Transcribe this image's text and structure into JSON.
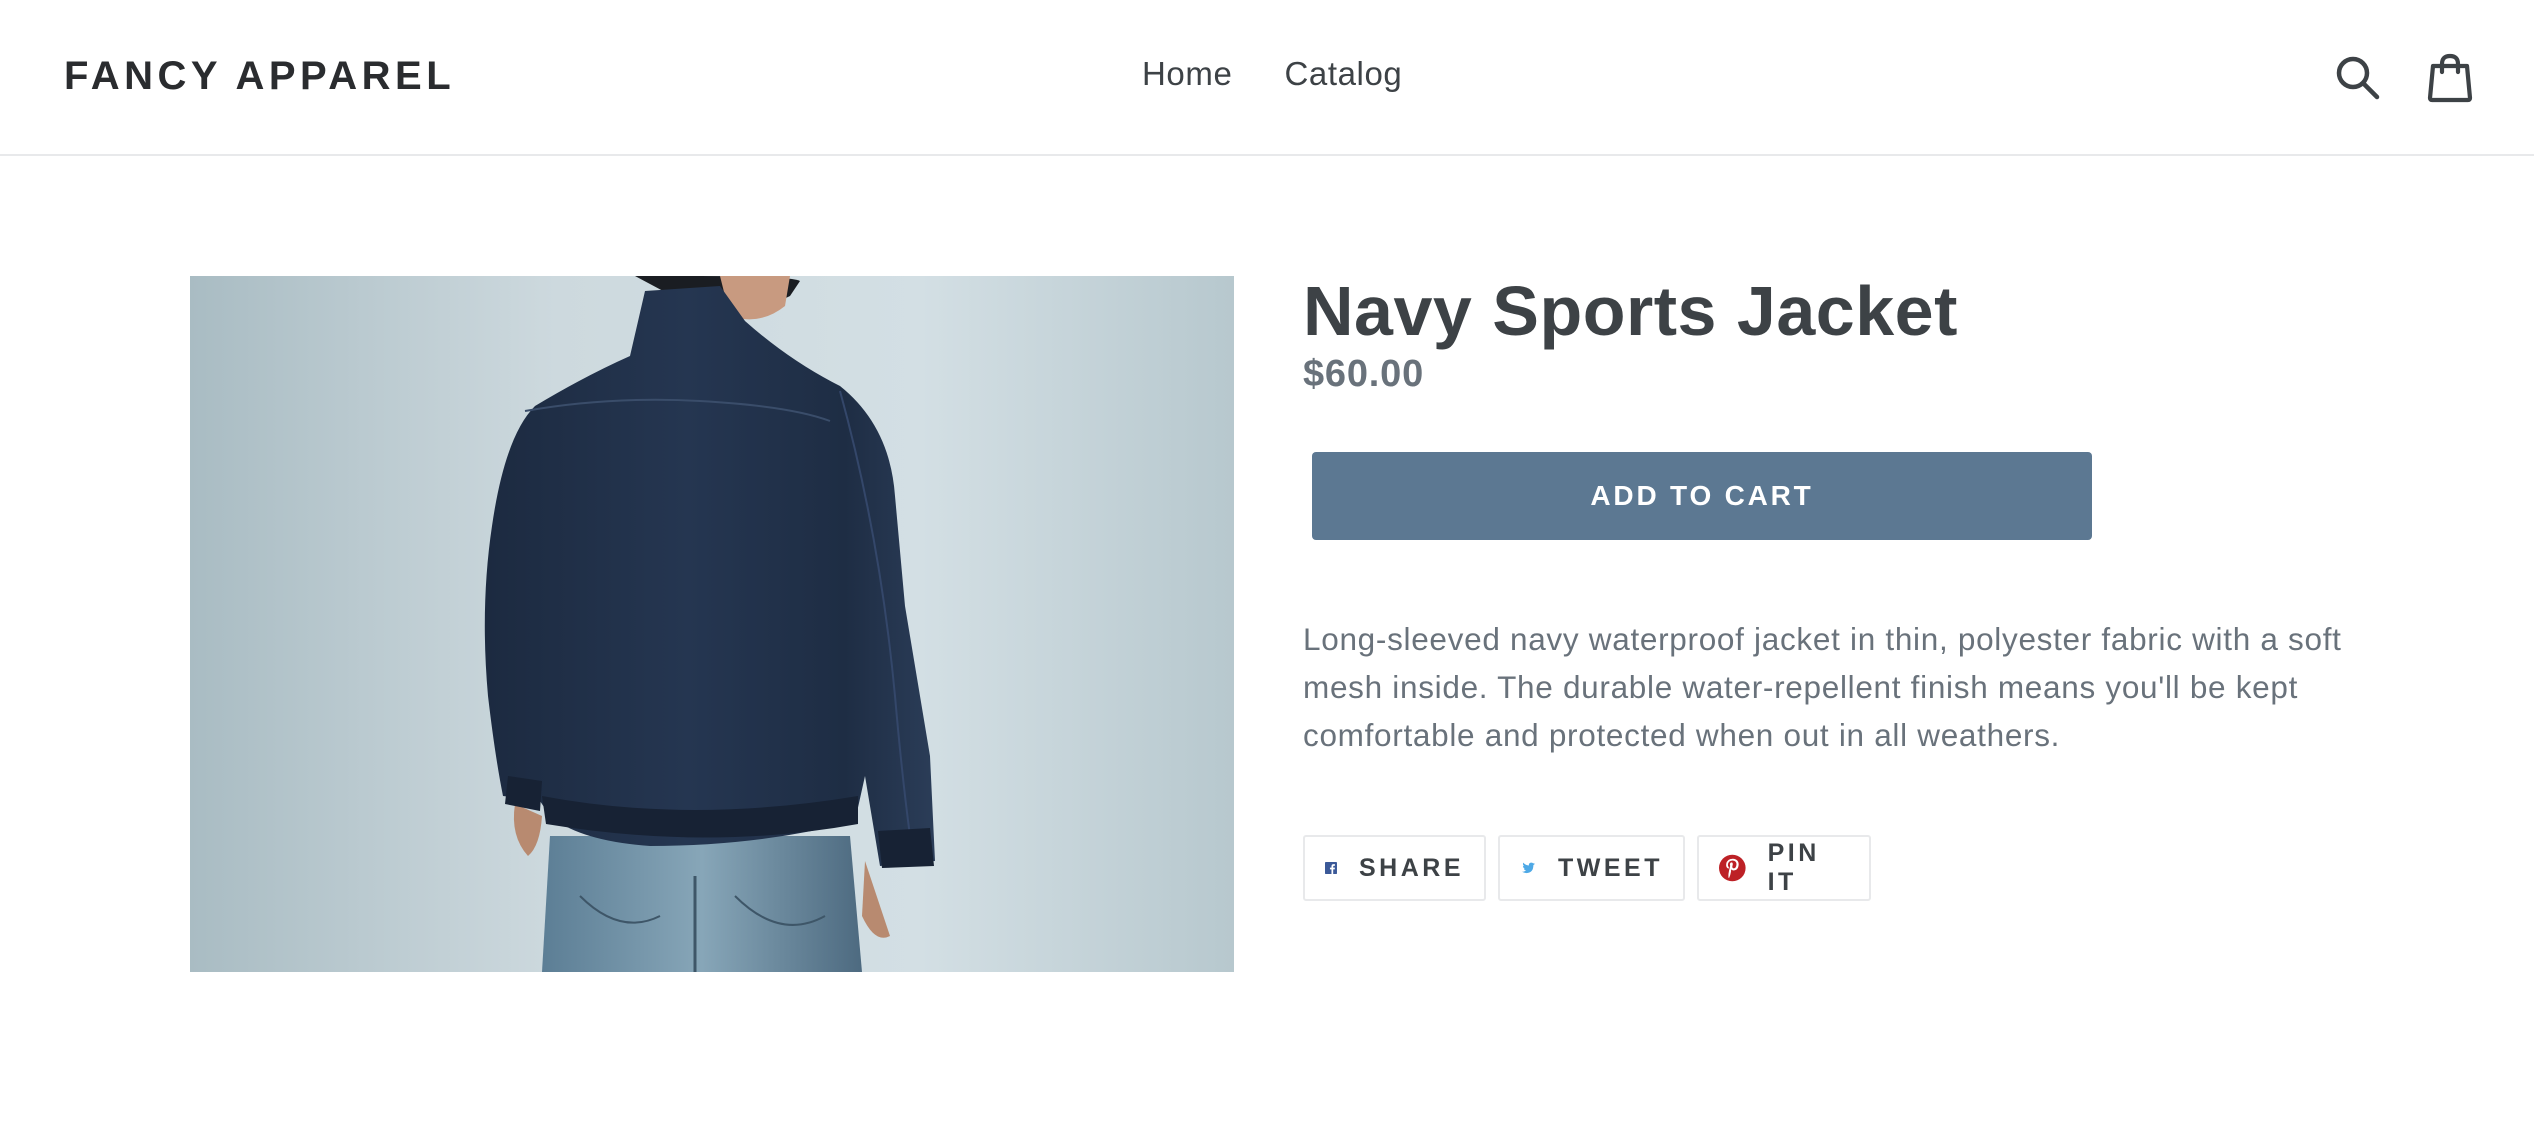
{
  "header": {
    "logo": "FANCY APPAREL",
    "nav": [
      {
        "label": "Home"
      },
      {
        "label": "Catalog"
      }
    ],
    "icons": {
      "search": "search-icon",
      "cart": "shopping-bag-icon"
    }
  },
  "product": {
    "image_alt": "Navy Sports Jacket",
    "title": "Navy Sports Jacket",
    "price": "$60.00",
    "add_to_cart_label": "ADD TO CART",
    "description": "Long-sleeved navy waterproof jacket in thin, polyester fabric with a soft mesh inside. The durable water-repellent finish means you'll be kept comfortable and protected when out in all weathers."
  },
  "share": [
    {
      "label": "SHARE",
      "icon": "facebook-icon",
      "color": "#3b5998"
    },
    {
      "label": "TWEET",
      "icon": "twitter-icon",
      "color": "#4ea9e6"
    },
    {
      "label": "PIN IT",
      "icon": "pinterest-icon",
      "color": "#bd2126"
    }
  ],
  "colors": {
    "accent": "#5c7892",
    "text": "#3d4246",
    "muted": "#69727b",
    "border": "#e8e9eb"
  }
}
